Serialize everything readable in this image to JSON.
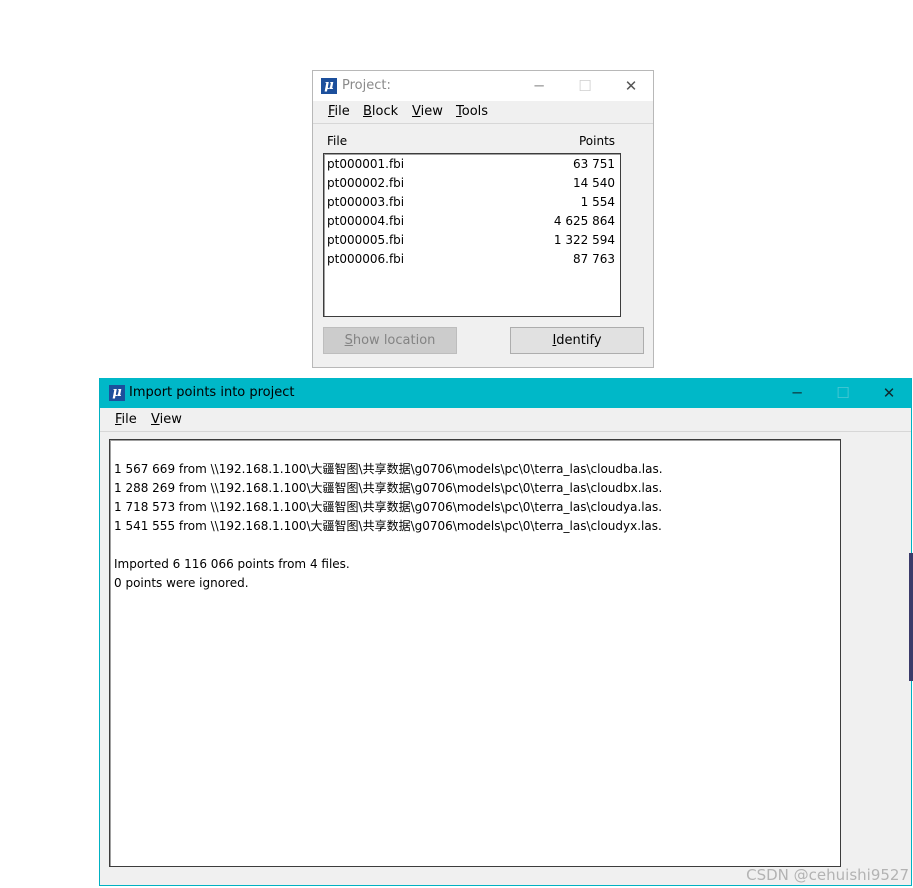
{
  "project": {
    "title": "Project:",
    "icon": "mu-app-icon",
    "menu": [
      {
        "label": "File",
        "mnemonic": "F",
        "rest": "ile"
      },
      {
        "label": "Block",
        "mnemonic": "B",
        "rest": "lock"
      },
      {
        "label": "View",
        "mnemonic": "V",
        "rest": "iew"
      },
      {
        "label": "Tools",
        "mnemonic": "T",
        "rest": "ools"
      }
    ],
    "columns": {
      "file": "File",
      "points": "Points"
    },
    "files": [
      {
        "name": "pt000001.fbi",
        "points": "63 751"
      },
      {
        "name": "pt000002.fbi",
        "points": "14 540"
      },
      {
        "name": "pt000003.fbi",
        "points": "1 554"
      },
      {
        "name": "pt000004.fbi",
        "points": "4 625 864"
      },
      {
        "name": "pt000005.fbi",
        "points": "1 322 594"
      },
      {
        "name": "pt000006.fbi",
        "points": "87 763"
      }
    ],
    "buttons": {
      "show_location": {
        "label": "Show location",
        "mnemonic": "S",
        "rest": "how location"
      },
      "identify": {
        "label": "Identify",
        "mnemonic": "I",
        "rest": "dentify"
      }
    },
    "window_controls": {
      "minimize": "─",
      "maximize": "☐",
      "close": "✕"
    }
  },
  "import": {
    "title": "Import points into project",
    "icon": "mu-app-icon",
    "menu": [
      {
        "label": "File",
        "mnemonic": "F",
        "rest": "ile"
      },
      {
        "label": "View",
        "mnemonic": "V",
        "rest": "iew"
      }
    ],
    "log": [
      "1 567 669 from \\\\192.168.1.100\\大疆智图\\共享数据\\g0706\\models\\pc\\0\\terra_las\\cloudba.las.",
      "1 288 269 from \\\\192.168.1.100\\大疆智图\\共享数据\\g0706\\models\\pc\\0\\terra_las\\cloudbx.las.",
      "1 718 573 from \\\\192.168.1.100\\大疆智图\\共享数据\\g0706\\models\\pc\\0\\terra_las\\cloudya.las.",
      "1 541 555 from \\\\192.168.1.100\\大疆智图\\共享数据\\g0706\\models\\pc\\0\\terra_las\\cloudyx.las.",
      "",
      "Imported 6 116 066 points from 4 files.",
      "0 points were ignored."
    ],
    "window_controls": {
      "minimize": "─",
      "maximize": "☐",
      "close": "✕"
    }
  },
  "watermark": "CSDN @cehuishi9527",
  "colors": {
    "import_titlebar": "#00b8c8",
    "app_icon": "#1c4f9c"
  }
}
